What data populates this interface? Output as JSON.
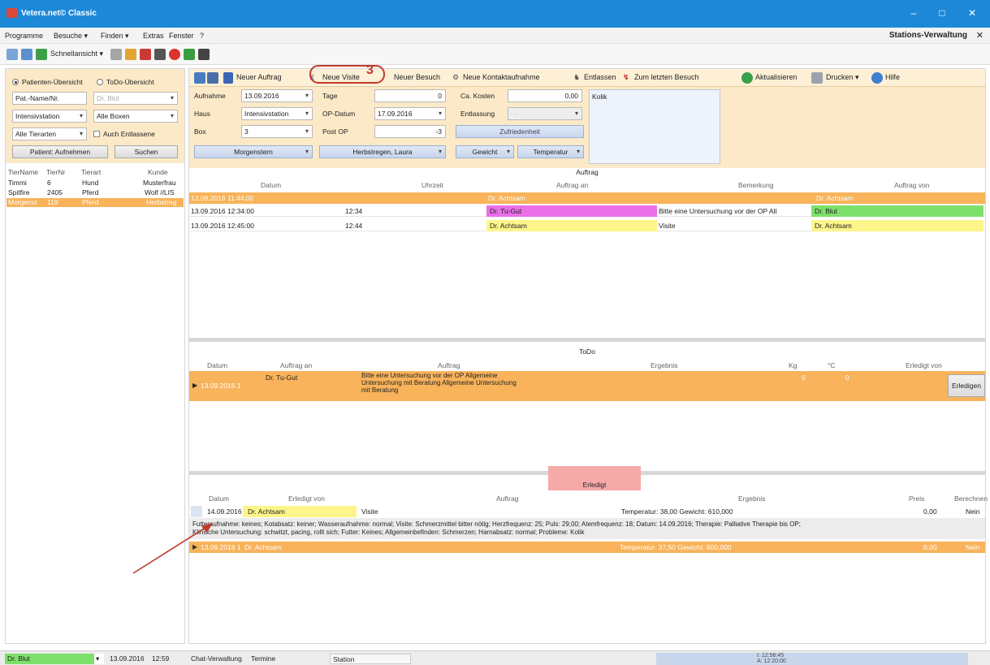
{
  "window": {
    "title": "Vetera.net© Classic",
    "min": "–",
    "max": "□",
    "close": "✕"
  },
  "menu": {
    "items": [
      "Programme",
      "Besuche ▾",
      "Finden ▾",
      "Extras",
      "Fenster",
      "?"
    ],
    "module_title": "Stations-Verwaltung",
    "module_close": "✕"
  },
  "toolbar1": {
    "schnellansicht": "Schnellansicht ▾"
  },
  "left": {
    "radio_patients": "Patienten-Übersicht",
    "radio_todo": "ToDo-Übersicht",
    "pat_name_field": "Pat.-Name/Nr.",
    "vet_select": "Dr. Blut",
    "station_select": "Intensivstation",
    "boxes_select": "Alle Boxen",
    "species_select": "Alle Tierarten",
    "include_discharged": "Auch Entlassene",
    "admit_button": "Patient: Aufnehmen",
    "search_button": "Suchen",
    "columns": [
      "TierName",
      "TierNr",
      "Tierart",
      "Kunde"
    ],
    "rows": [
      {
        "name": "Timmi",
        "nr": "6",
        "art": "Hund",
        "kunde": "Musterfrau"
      },
      {
        "name": "Spitfire",
        "nr": "2405",
        "art": "Pferd",
        "kunde": "Wolf //LIS"
      },
      {
        "name": "Morgenst",
        "nr": "119",
        "art": "Pferd",
        "kunde": "Herbstreg"
      }
    ]
  },
  "toolbar2": {
    "neuer_auftrag": "Neuer Auftrag",
    "neue_visite": "Neue Visite",
    "neuer_besuch": "Neuer Besuch",
    "neue_kontakt": "Neue Kontaktaufnahme",
    "entlassen": "Entlassen",
    "zum_letzten": "Zum letzten Besuch",
    "aktualisieren": "Aktualisieren",
    "drucken": "Drucken ▾",
    "hilfe": "Hilfe",
    "callout_number": "3"
  },
  "form": {
    "aufnahme_label": "Aufnahme",
    "aufnahme_value": "13.09.2016",
    "haus_label": "Haus",
    "haus_value": "Intensivstation",
    "box_label": "Box",
    "box_value": "3",
    "tage_label": "Tage",
    "tage_value": "0",
    "opdatum_label": "OP-Datum",
    "opdatum_value": "17.09.2016",
    "postop_label": "Post OP",
    "postop_value": "-3",
    "kosten_label": "Ca. Kosten",
    "kosten_value": "0,00",
    "entlassung_label": "Entlassung",
    "entlassung_value": "-  -",
    "zufriedenheit": "Zufriedenheit",
    "note": "Kolik",
    "patient_name": "Morgenstern",
    "owner_name": "Herbstregen, Laura",
    "gewicht": "Gewicht",
    "temperatur": "Temperatur"
  },
  "auftrag": {
    "title": "Auftrag",
    "columns": [
      "Datum",
      "Uhrzeit",
      "Auftrag an",
      "Bemerkung",
      "Auftrag von"
    ],
    "rows": [
      {
        "datum": "13.09.2016 11:44:00",
        "uhrzeit": "",
        "an": "Dr. Achtsam",
        "bemerkung": "",
        "von": "Dr. Achtsam"
      },
      {
        "datum": "13.09.2016 12:34:00",
        "uhrzeit": "12:34",
        "an": "Dr. Tu-Gut",
        "bemerkung": "Bitte eine Untersuchung vor der OP All",
        "von": "Dr. Blut"
      },
      {
        "datum": "13.09.2016 12:45:00",
        "uhrzeit": "12:44",
        "an": "Dr. Achtsam",
        "bemerkung": "Visite",
        "von": "Dr. Achtsam"
      }
    ]
  },
  "todo": {
    "title": "ToDo",
    "columns": [
      "Datum",
      "Auftrag an",
      "Auftrag",
      "Ergebnis",
      "Kg",
      "°C",
      "Erledigt von"
    ],
    "row": {
      "datum": "13.09.2016 1",
      "an": "Dr. Tu-Gut",
      "auftrag_lines": [
        "Bitte eine Untersuchung vor der OP Allgemeine",
        "Untersuchung mit Beratung Allgemeine Untersuchung",
        "mit Beratung"
      ],
      "kg": "0",
      "c": "0",
      "button": "Erledigen"
    }
  },
  "erledigt": {
    "title": "Erledigt",
    "columns": [
      "Datum",
      "Erledigt von",
      "Auftrag",
      "Ergebnis",
      "Preis",
      "Berechnen"
    ],
    "rows": [
      {
        "datum": "14.09.2016 0",
        "von": "Dr. Achtsam",
        "auftrag": "Visite",
        "ergebnis": "Temperatur: 38,00 Gewicht: 610,000",
        "preis": "0,00",
        "berechnen": "Nein"
      },
      {
        "datum": "13.09.2016 1",
        "von": "Dr. Achtsam",
        "auftrag": "",
        "ergebnis": "Temperatur: 37,50 Gewicht: 600,000",
        "preis": "0,00",
        "berechnen": "Nein"
      }
    ],
    "detail_line1": "Futteraufnahme: keines;  Kotabsatz: keiner;  Wasseraufnahme: normal;  Visite: Schmerzmittel bitter nötig;  Herzfrequenz: 25;  Puls: 29,00;  Atemfrequenz: 18;  Datum: 14.09.2016;  Therapie: Palliative Therapie bis OP;",
    "detail_line2": "Klinische Untersuchung: schwitzt, pacing, rollt sich;  Futter: Keines;  Allgemeinbefinden: Schmerzen;  Harnabsatz: normal;  Probleme: Kolik"
  },
  "status": {
    "user": "Dr. Blut",
    "date": "13.09.2016",
    "time": "12:59",
    "tabs": [
      "Chat-Verwaltung",
      "Termine",
      "Station"
    ],
    "clock1": "I: 12:56:45",
    "clock2": "A: 12:20:00"
  },
  "colors": {
    "title_blue": "#1e88d8",
    "orange_row": "#f8b35b",
    "yellow_cell": "#fdf58a",
    "pink_cell": "#ea6fe8",
    "green_cell": "#7de06a",
    "callout_red": "#c0392b"
  }
}
